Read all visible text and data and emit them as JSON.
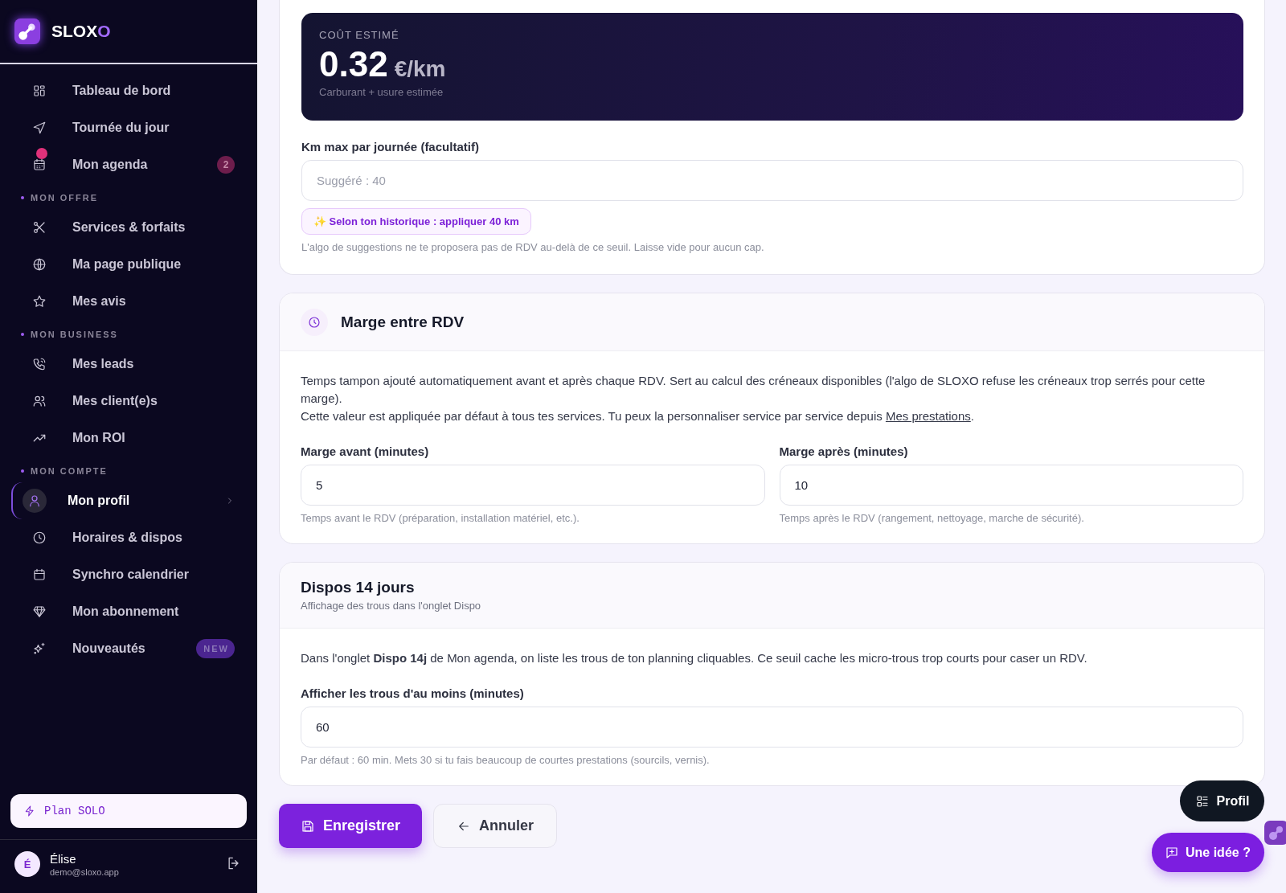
{
  "sidebar": {
    "brand": {
      "name": "SLOX",
      "accent": "O"
    },
    "nav": [
      {
        "kind": "item",
        "label": "Tableau de bord",
        "selected": false,
        "notification": false
      },
      {
        "kind": "item",
        "label": "Tournée du jour",
        "selected": false,
        "notification": false
      },
      {
        "kind": "item",
        "label": "Mon agenda",
        "selected": false,
        "notification": true,
        "badge": "2"
      },
      {
        "kind": "section",
        "label": "MON OFFRE"
      },
      {
        "kind": "item",
        "label": "Services & forfaits",
        "selected": false,
        "notification": false
      },
      {
        "kind": "item",
        "label": "Ma page publique",
        "selected": false,
        "notification": false
      },
      {
        "kind": "item",
        "label": "Mes avis",
        "selected": false,
        "notification": false
      },
      {
        "kind": "section",
        "label": "MON BUSINESS"
      },
      {
        "kind": "item",
        "label": "Mes leads",
        "selected": false,
        "notification": false
      },
      {
        "kind": "item",
        "label": "Mes client(e)s",
        "selected": false,
        "notification": false
      },
      {
        "kind": "item",
        "label": "Mon ROI",
        "selected": false,
        "notification": false
      },
      {
        "kind": "section",
        "label": "MON COMPTE"
      },
      {
        "kind": "item",
        "label": "Mon profil",
        "selected": true,
        "notification": false
      },
      {
        "kind": "item",
        "label": "Horaires & dispos",
        "selected": false,
        "notification": false
      },
      {
        "kind": "item",
        "label": "Synchro calendrier",
        "selected": false,
        "notification": false
      },
      {
        "kind": "item",
        "label": "Mon abonnement",
        "selected": false,
        "notification": false
      },
      {
        "kind": "item",
        "label": "Nouveautés",
        "selected": false,
        "notification": false,
        "tag": "NEW"
      }
    ],
    "plan": "Plan SOLO",
    "user": {
      "initial": "É",
      "name": "Élise",
      "email": "demo@sloxo.app"
    }
  },
  "cost": {
    "label": "COÛT ESTIMÉ",
    "value": "0.32",
    "unit": "€/km",
    "caption": "Carburant + usure estimée"
  },
  "km_field": {
    "label": "Km max par journée (facultatif)",
    "placeholder": "Suggéré : 40",
    "suggestion": "✨ Selon ton historique : appliquer 40 km",
    "help": "L'algo de suggestions ne te proposera pas de RDV au-delà de ce seuil. Laisse vide pour aucun cap."
  },
  "margin_section": {
    "title": "Marge entre RDV",
    "paragraph": "Temps tampon ajouté automatiquement avant et après chaque RDV. Sert au calcul des créneaux disponibles (l'algo de SLOXO refuse les créneaux trop serrés pour cette marge).",
    "note": {
      "before": "Cette valeur est appliquée par défaut à tous tes services. Tu peux la personnaliser service par service depuis ",
      "link": "Mes prestations",
      "after": "."
    },
    "fields": [
      {
        "label": "Marge avant (minutes)",
        "value": "5",
        "help": "Temps avant le RDV (préparation, installation matériel, etc.)."
      },
      {
        "label": "Marge après (minutes)",
        "value": "10",
        "help": "Temps après le RDV (rangement, nettoyage, marche de sécurité)."
      }
    ]
  },
  "dispo_section": {
    "title": "Dispos 14 jours",
    "subtitle": "Affichage des trous dans l'onglet Dispo",
    "paragraph": "Dans l'onglet **Dispo 14j** de Mon agenda, on liste les trous de ton planning cliquables. Ce seuil cache les micro-trous trop courts pour caser un RDV.",
    "field": {
      "label": "Afficher les trous d'au moins (minutes)",
      "value": "60",
      "help": "Par défaut : 60 min. Mets 30 si tu fais beaucoup de courtes prestations (sourcils, vernis)."
    }
  },
  "actions": {
    "save": "Enregistrer",
    "cancel": "Annuler"
  },
  "floating": {
    "profile": "Profil",
    "idea": "Une idée ?"
  }
}
